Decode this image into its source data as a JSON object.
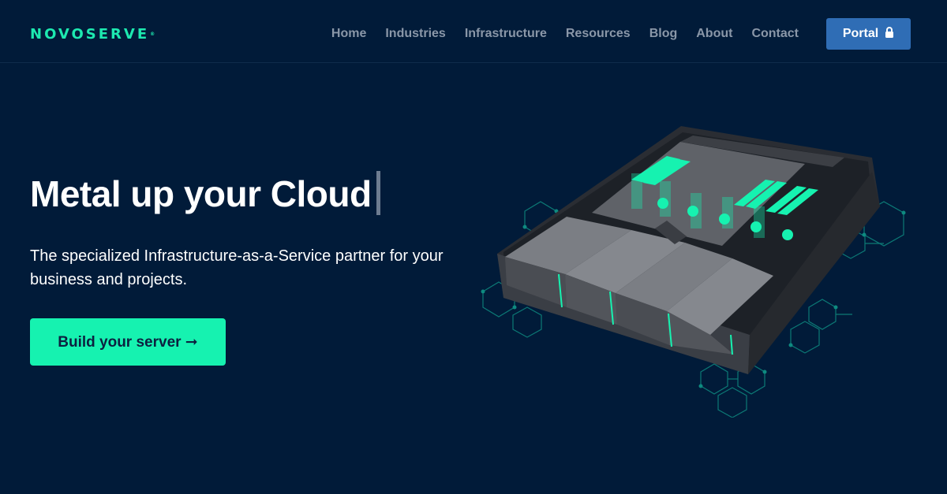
{
  "brand": {
    "logo_text": "NOVOSERVE",
    "trademark": "®"
  },
  "nav": {
    "items": [
      {
        "label": "Home"
      },
      {
        "label": "Industries"
      },
      {
        "label": "Infrastructure"
      },
      {
        "label": "Resources"
      },
      {
        "label": "Blog"
      },
      {
        "label": "About"
      },
      {
        "label": "Contact"
      }
    ],
    "portal_label": "Portal",
    "portal_icon": "lock-icon"
  },
  "hero": {
    "title": "Metal up your Cloud",
    "subtitle": "The specialized Infrastructure-as-a-Service partner for your business and projects.",
    "cta_label": "Build your server ➞"
  },
  "colors": {
    "background": "#011b39",
    "accent": "#16f2b0",
    "portal": "#2f6db5",
    "nav_text": "#8a97a8"
  }
}
